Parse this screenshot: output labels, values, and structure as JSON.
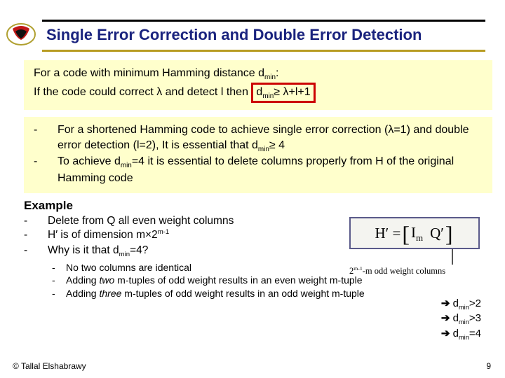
{
  "title": "Single Error Correction and Double Error Detection",
  "panel1": {
    "line1_a": "For a code with minimum Hamming distance d",
    "line1_sub": "min",
    "line1_b": ":",
    "line2_a": "If the code could correct λ and detect l then ",
    "boxed_a": "d",
    "boxed_sub": "min",
    "boxed_b": "≥ λ+l+1"
  },
  "panel2": {
    "item1_a": "For a shortened Hamming code to achieve single error correction (λ=1) and double error detection (l=2), It is essential that d",
    "item1_sub": "min",
    "item1_b": "≥ 4",
    "item2_a": "To achieve d",
    "item2_sub": "min",
    "item2_b": "=4 it is essential to delete columns properly from H of the original Hamming code"
  },
  "example_head": "Example",
  "ex": {
    "e1": "Delete from Q all even weight columns",
    "e2_a": "H′ is of dimension m×2",
    "e2_sup": "m-1",
    "e3_a": "Why is it that d",
    "e3_sub": "min",
    "e3_b": "=4?"
  },
  "sub": {
    "s1": "No two columns are identical",
    "s2_a": "Adding ",
    "s2_i": "two",
    "s2_b": " m-tuples of odd weight results in an even weight m-tuple",
    "s3_a": "Adding ",
    "s3_i": "three",
    "s3_b": " m-tuples of odd weight results in an odd weight m-tuple"
  },
  "matrix": {
    "H": "H′ =",
    "I": "I",
    "Isub": "m",
    "Q": "Q′",
    "callout_a": "2",
    "callout_sup": "m-1",
    "callout_b": "-m odd weight columns"
  },
  "results": {
    "r1a": "d",
    "r1sub": "min",
    "r1b": ">2",
    "r2a": "d",
    "r2sub": "min",
    "r2b": ">3",
    "r3a": "d",
    "r3sub": "min",
    "r3b": "=4"
  },
  "footer": {
    "copyright": "© Tallal Elshabrawy",
    "page": "9"
  }
}
